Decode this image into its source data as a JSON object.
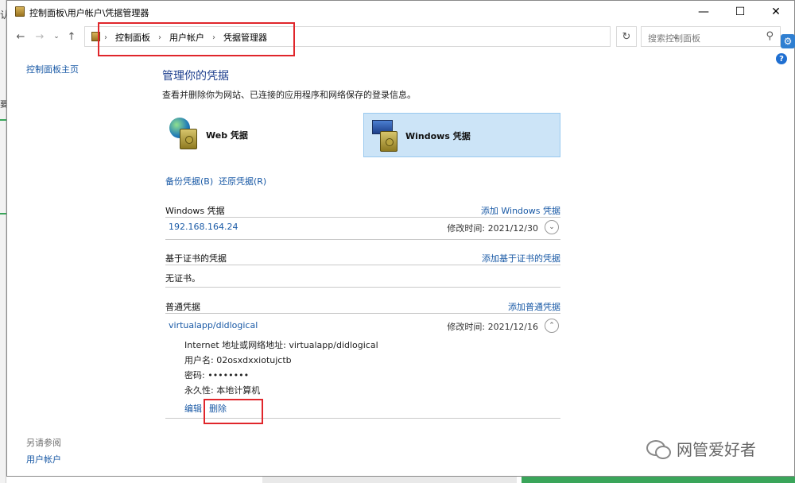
{
  "window": {
    "title": "控制面板\\用户帐户\\凭据管理器"
  },
  "left_strip": {
    "char1": "认",
    "char2": "要"
  },
  "address": {
    "crumbs": [
      "控制面板",
      "用户帐户",
      "凭据管理器"
    ],
    "search_placeholder": "搜索控制面板"
  },
  "side": {
    "home": "控制面板主页",
    "see_also": "另请参阅",
    "user_accounts": "用户帐户"
  },
  "main": {
    "title": "管理你的凭据",
    "description": "查看并删除你为网站、已连接的应用程序和网络保存的登录信息。",
    "tiles": {
      "web": "Web 凭据",
      "windows": "Windows 凭据"
    },
    "backup": "备份凭据(B)",
    "restore": "还原凭据(R)"
  },
  "windows_section": {
    "title": "Windows 凭据",
    "add": "添加 Windows 凭据",
    "items": [
      {
        "name": "192.168.164.24",
        "modified": "修改时间:  2021/12/30"
      }
    ]
  },
  "cert_section": {
    "title": "基于证书的凭据",
    "add": "添加基于证书的凭据",
    "empty": "无证书。"
  },
  "generic_section": {
    "title": "普通凭据",
    "add": "添加普通凭据",
    "item": {
      "name": "virtualapp/didlogical",
      "modified": "修改时间:  2021/12/16",
      "address": "Internet 地址或网络地址:  virtualapp/didlogical",
      "username": "用户名:  02osxdxxiotujctb",
      "password": "密码:  ••••••••",
      "persistence": "永久性:  本地计算机",
      "edit": "编辑",
      "delete": "删除"
    }
  },
  "watermark": "网管爱好者",
  "colors": {
    "link": "#1a5aa6",
    "title_blue": "#1e3f8e",
    "selected_tile": "#cce4f7",
    "highlight_red": "#e0262b"
  }
}
